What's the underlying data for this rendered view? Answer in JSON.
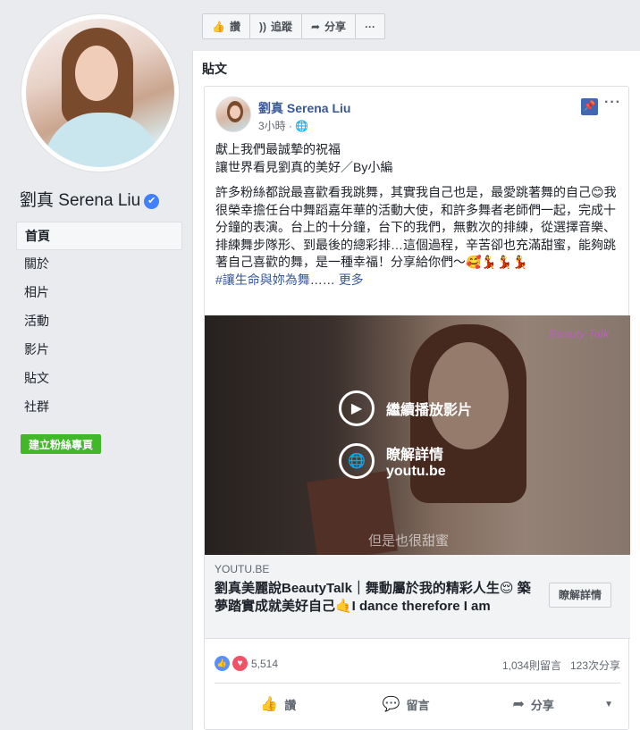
{
  "sidebar": {
    "page_name": "劉真 Serena Liu",
    "verified_badge": "✔",
    "nav": [
      {
        "label": "首頁",
        "active": true
      },
      {
        "label": "關於"
      },
      {
        "label": "相片"
      },
      {
        "label": "活動"
      },
      {
        "label": "影片"
      },
      {
        "label": "貼文"
      },
      {
        "label": "社群"
      }
    ],
    "create_page_button": "建立粉絲專頁"
  },
  "actionbar": {
    "like": "讚",
    "follow": "追蹤",
    "share": "分享",
    "more": "···"
  },
  "posts": {
    "section_title": "貼文",
    "post": {
      "author": "劉真 Serena Liu",
      "time": "3小時 · ",
      "visibility_icon": "globe-icon",
      "more_icon": "···",
      "text_line1": "獻上我們最誠摯的祝福",
      "text_line2": "讓世界看見劉真的美好／By小編",
      "body": "許多粉絲都說最喜歡看我跳舞，其實我自己也是，最愛跳著舞的自己😊我很榮幸擔任台中舞蹈嘉年華的活動大使，和許多舞者老師們一起，完成十分鐘的表演。台上的十分鐘，台下的我們，無數次的排練，從選擇音樂、排練舞步隊形、到最後的總彩排…這個過程，辛苦卻也充滿甜蜜，能夠跳著自己喜歡的舞，是一種幸福！分享給你們～🥰💃💃💃",
      "hashtag": "#讓生命與妳為舞",
      "ellipsis": "…… ",
      "more_link": "更多",
      "video": {
        "brand": "Beauty Talk",
        "continue_label": "繼續播放影片",
        "learn_label": "瞭解詳情",
        "learn_domain": "youtu.be",
        "caption": "但是也很甜蜜"
      },
      "link": {
        "domain": "YOUTU.BE",
        "title": "劉真美麗說BeautyTalk｜舞動屬於我的精彩人生😌 築夢踏實成就美好自己🤙I dance therefore I am",
        "learn_button": "瞭解詳情"
      },
      "stats": {
        "reactions": "5,514",
        "comments": "1,034則留言",
        "shares": "123次分享"
      },
      "footer": {
        "like": "讚",
        "comment": "留言",
        "share": "分享"
      }
    }
  }
}
